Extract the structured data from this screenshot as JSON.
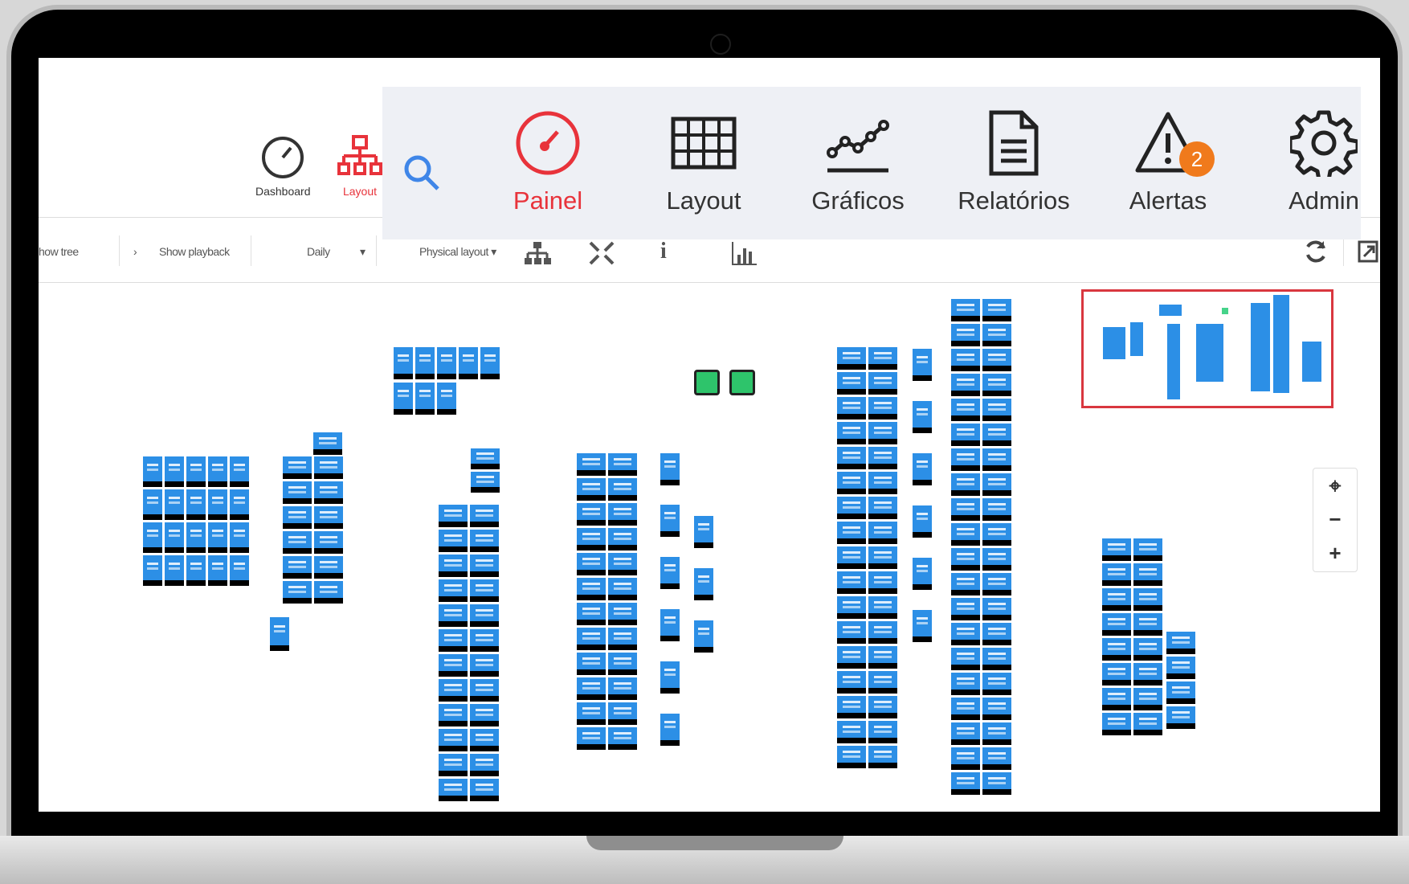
{
  "topnav": {
    "dashboard_label": "Dashboard",
    "layout_label": "Layout"
  },
  "toolbar": {
    "show_tree": "how tree",
    "show_playback": "Show playback",
    "period": "Daily",
    "layout_mode": "Physical layout ▾"
  },
  "menu": {
    "items": [
      {
        "label": "Painel",
        "icon": "speedometer-icon",
        "active": true
      },
      {
        "label": "Layout",
        "icon": "grid-icon",
        "active": false
      },
      {
        "label": "Gráficos",
        "icon": "line-chart-icon",
        "active": false
      },
      {
        "label": "Relatórios",
        "icon": "document-icon",
        "active": false
      },
      {
        "label": "Alertas",
        "icon": "warning-icon",
        "active": false,
        "badge": "2"
      },
      {
        "label": "Admin",
        "icon": "gear-icon",
        "active": false
      }
    ]
  },
  "zoom": {
    "locate": "⌖",
    "minus": "−",
    "plus": "+"
  },
  "colors": {
    "accent": "#e8333b",
    "tile": "#2c8fe6",
    "badge": "#f07a1c",
    "ok": "#2ec46b"
  }
}
